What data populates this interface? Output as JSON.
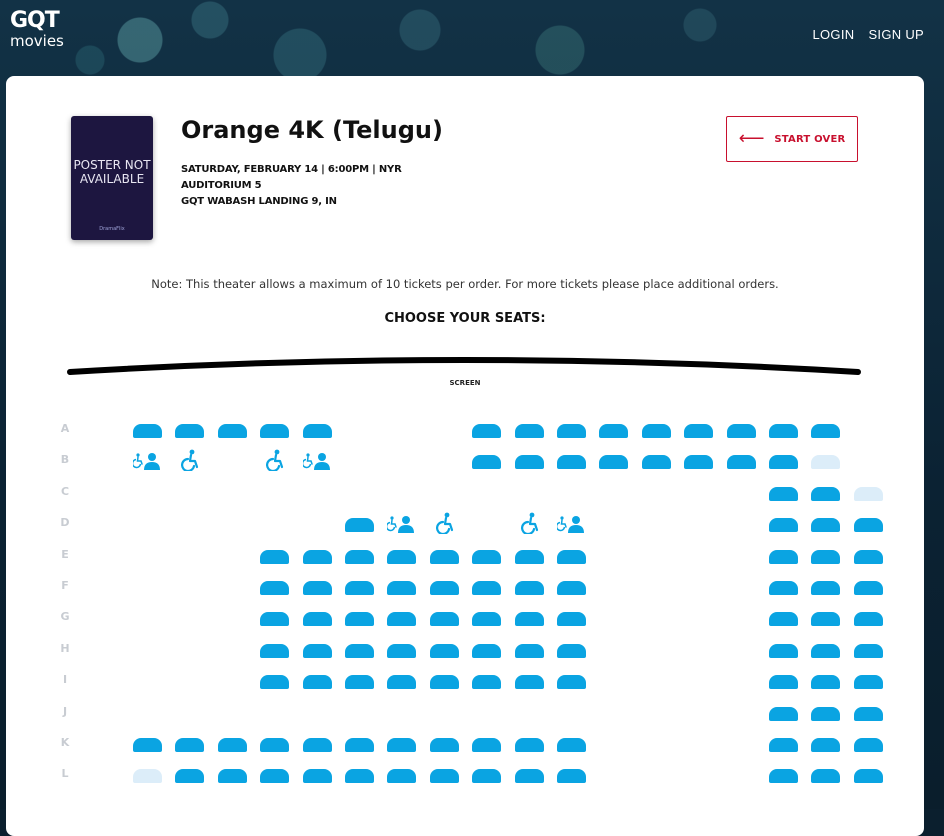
{
  "header": {
    "logo_main": "GQT",
    "logo_sub": "movies",
    "nav": [
      "LOGIN",
      "SIGN UP"
    ]
  },
  "movie": {
    "poster_text": "POSTER NOT AVAILABLE",
    "poster_brand": "DramaFlix",
    "title": "Orange 4K (Telugu)",
    "showtime": "SATURDAY, FEBRUARY 14 | 6:00PM | NYR",
    "auditorium": "AUDITORIUM 5",
    "theater": "GQT WABASH LANDING 9, IN"
  },
  "start_over": {
    "label": "START OVER",
    "icon": "arrow-left-icon"
  },
  "note": "Note: This theater allows a maximum of 10 tickets per order. For more tickets please place additional orders.",
  "choose_label": "CHOOSE YOUR SEATS:",
  "screen_label": "SCREEN",
  "colors": {
    "accent": "#c8102e",
    "seat_available": "#0aa4e2",
    "seat_unavailable": "#dcedf9",
    "row_label": "#c8ccd2"
  },
  "seat_map": {
    "legend": {
      "a": "available seat",
      "u": "unavailable seat",
      "c": "companion seat (wheelchair-icon + person-icon)",
      "w": "wheelchair seat (wheelchair-icon)",
      ".": "no seat"
    },
    "rows": [
      {
        "label": "A",
        "seats": "aaaaa...aaaaaaaaa"
      },
      {
        "label": "B",
        "seats": "cw.wc...aaaaaaaau"
      },
      {
        "label": "C",
        "seats": "...............aau"
      },
      {
        "label": "D",
        "seats": ".....acw.wc....aaa"
      },
      {
        "label": "E",
        "seats": "...aaaaaaaa....aaa"
      },
      {
        "label": "F",
        "seats": "...aaaaaaaa....aaa"
      },
      {
        "label": "G",
        "seats": "...aaaaaaaa....aaa"
      },
      {
        "label": "H",
        "seats": "...aaaaaaaa....aaa"
      },
      {
        "label": "I",
        "seats": "...aaaaaaaa....aaa"
      },
      {
        "label": "J",
        "seats": "...............aaa"
      },
      {
        "label": "K",
        "seats": "aaaaaaaaaaa....aaa"
      },
      {
        "label": "L",
        "seats": "uaaaaaaaaaa....aaa"
      }
    ]
  }
}
